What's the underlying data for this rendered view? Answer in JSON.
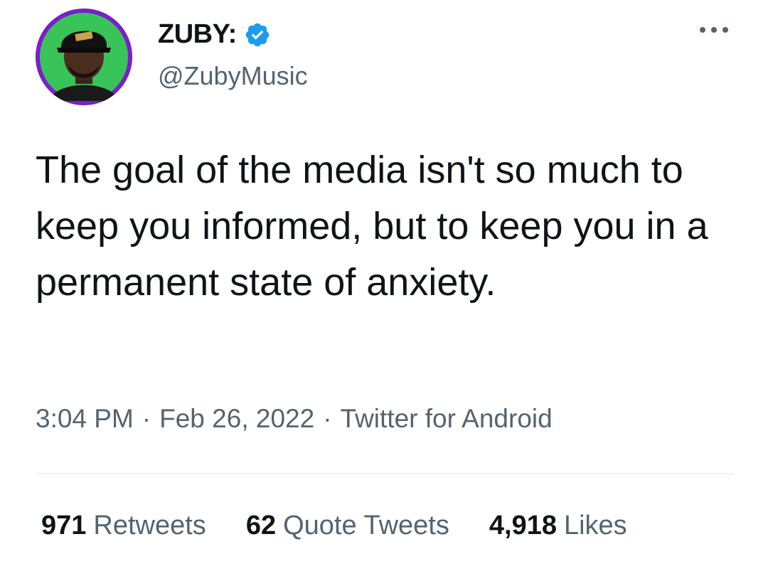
{
  "author": {
    "display_name": "ZUBY:",
    "handle": "@ZubyMusic",
    "verified_badge": "verified-badge-icon",
    "avatar_ring_color": "#7a1fc9"
  },
  "tweet": {
    "text": "The goal of the media isn't so much to keep you informed, but to keep you in a permanent state of anxiety."
  },
  "meta": {
    "time": "3:04 PM",
    "separator": "·",
    "date": "Feb 26, 2022",
    "source": "Twitter for Android"
  },
  "stats": {
    "retweets_count": "971",
    "retweets_label": "Retweets",
    "quotes_count": "62",
    "quotes_label": "Quote Tweets",
    "likes_count": "4,918",
    "likes_label": "Likes"
  },
  "colors": {
    "text_primary": "#0f1419",
    "text_secondary": "#536471",
    "verified_blue": "#1d9bf0",
    "divider": "#eff3f4"
  }
}
